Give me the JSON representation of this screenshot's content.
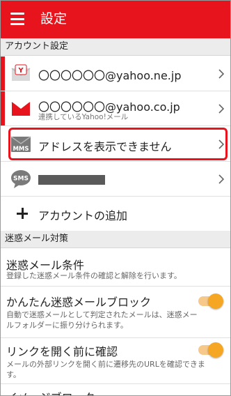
{
  "app_bar": {
    "title": "設定"
  },
  "sections": {
    "accounts_header": "アカウント設定",
    "spam_header": "迷惑メール対策"
  },
  "accounts": [
    {
      "address": "〇〇〇〇〇〇@yahoo.ne.jp",
      "sub": "",
      "icon": "yahoo-mail-envelope-icon"
    },
    {
      "address": "〇〇〇〇〇〇@yahoo.co.jp",
      "sub": "連携しているYahoo!メール",
      "icon": "red-envelope-icon"
    },
    {
      "address": "アドレスを表示できません",
      "sub": "",
      "icon": "mms-envelope-icon",
      "icon_label": "MMS"
    },
    {
      "address": "",
      "sub": "",
      "icon": "sms-bubble-icon",
      "icon_label": "SMS",
      "masked": true
    }
  ],
  "add_account": {
    "label": "アカウントの追加"
  },
  "spam_settings": [
    {
      "title": "迷惑メール条件",
      "desc": "登録した迷惑メール条件の確認と解除を行います。",
      "toggle": null
    },
    {
      "title": "かんたん迷惑メールブロック",
      "desc": "自動で迷惑メールとして判定されたメールは、迷惑メールフォルダーに振り分けられます。",
      "toggle": true
    },
    {
      "title": "リンクを開く前に確認",
      "desc": "メールの外部リンクを開く前に遷移先のURLを確認できます。",
      "toggle": true
    },
    {
      "title": "イメージブロック",
      "desc": "",
      "toggle": null
    }
  ],
  "colors": {
    "brand_red": "#e8141d",
    "toggle_on": "#f5a623",
    "section_bg": "#ececec"
  }
}
